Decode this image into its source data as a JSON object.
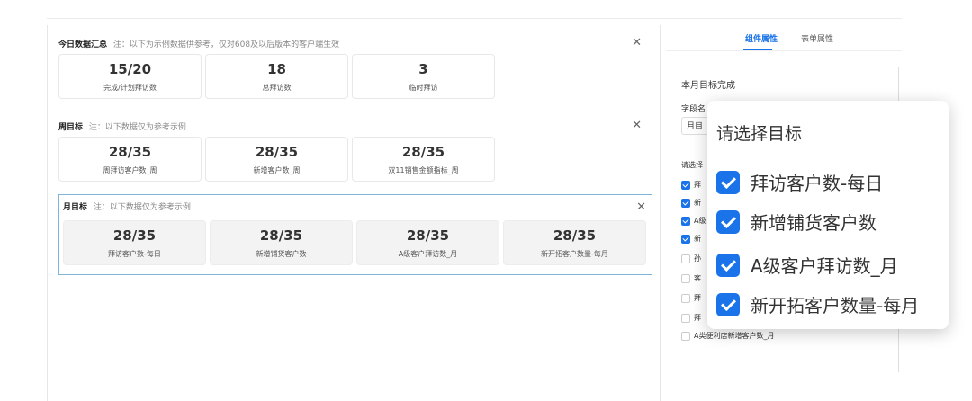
{
  "sections": [
    {
      "title": "今日数据汇总",
      "note": "注：以下为示例数据供参考，仅对608及以后版本的客户端生效",
      "cards": [
        {
          "value": "15/20",
          "label": "完成/计划拜访数"
        },
        {
          "value": "18",
          "label": "总拜访数"
        },
        {
          "value": "3",
          "label": "临时拜访"
        }
      ]
    },
    {
      "title": "周目标",
      "note": "注：以下数据仅为参考示例",
      "cards": [
        {
          "value": "28/35",
          "label": "周拜访客户数_周"
        },
        {
          "value": "28/35",
          "label": "新增客户数_周"
        },
        {
          "value": "28/35",
          "label": "双11销售金额指标_周"
        }
      ]
    },
    {
      "title": "月目标",
      "note": "注：以下数据仅为参考示例",
      "cards": [
        {
          "value": "28/35",
          "label": "拜访客户数-每日"
        },
        {
          "value": "28/35",
          "label": "新增铺货客户数"
        },
        {
          "value": "28/35",
          "label": "A级客户拜访数_月"
        },
        {
          "value": "28/35",
          "label": "新开拓客户数量-每月"
        }
      ]
    }
  ],
  "close_glyph": "✕",
  "right": {
    "tabs": [
      "组件属性",
      "表单属性"
    ],
    "prop_title": "本月目标完成",
    "field_label": "字段名",
    "field_value": "月目",
    "select_label": "请选择",
    "options": [
      {
        "text": "拜",
        "checked": true
      },
      {
        "text": "新",
        "checked": true
      },
      {
        "text": "A级",
        "checked": true
      },
      {
        "text": "新",
        "checked": true
      },
      {
        "text": "孙",
        "checked": false
      },
      {
        "text": "客",
        "checked": false
      },
      {
        "text": "拜",
        "checked": false
      },
      {
        "text": "拜",
        "checked": false
      },
      {
        "text": "A类便利店新增客户数_月",
        "checked": false
      }
    ]
  },
  "popup": {
    "title": "请选择目标",
    "items": [
      "拜访客户数-每日",
      "新增铺货客户数",
      "A级客户拜访数_月",
      "新开拓客户数量-每月"
    ]
  }
}
